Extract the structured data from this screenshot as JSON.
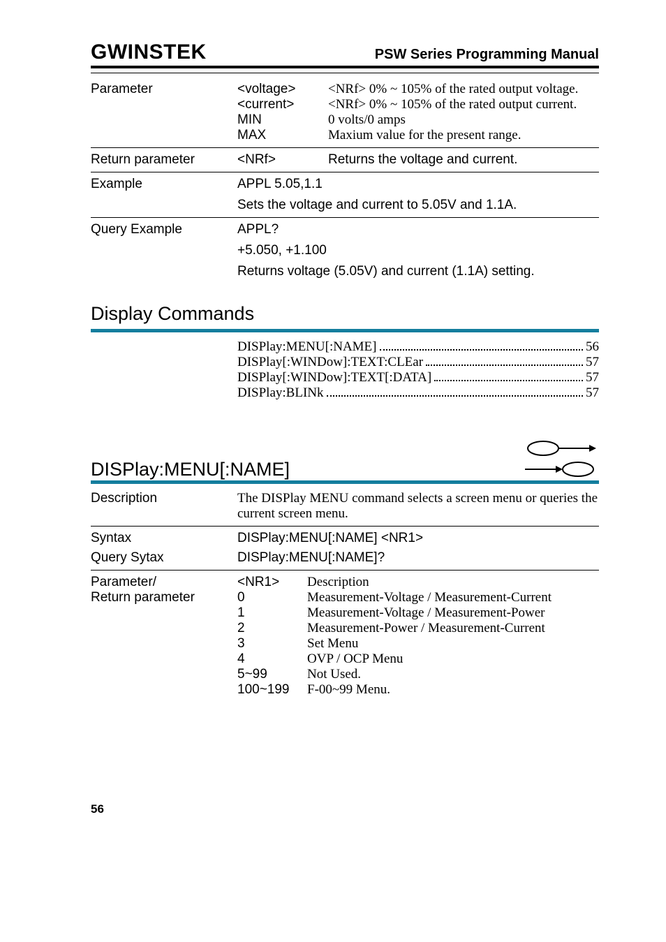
{
  "header": {
    "logo": "GWINSTEK",
    "title": "PSW Series Programming Manual"
  },
  "param_block": {
    "label": "Parameter",
    "rows": [
      {
        "mid": "<voltage>",
        "val": "<NRf> 0% ~ 105% of the rated output voltage."
      },
      {
        "mid": "<current>",
        "val": "<NRf> 0% ~ 105% of the rated output current."
      },
      {
        "mid": "MIN",
        "val": "0 volts/0 amps"
      },
      {
        "mid": "MAX",
        "val": "Maxium value for the present range."
      }
    ]
  },
  "return_param": {
    "label": "Return parameter",
    "mid": "<NRf>",
    "val": "Returns the voltage and current."
  },
  "example": {
    "label": "Example",
    "line1": "APPL 5.05,1.1",
    "line2": "Sets the voltage and current to 5.05V and 1.1A."
  },
  "query_example": {
    "label": "Query Example",
    "line1": "APPL?",
    "line2": "+5.050, +1.100",
    "line3": "Returns voltage (5.05V) and current (1.1A) setting."
  },
  "display_cmds": {
    "heading": "Display Commands",
    "toc": [
      {
        "t": "DISPlay:MENU[:NAME]",
        "p": "56"
      },
      {
        "t": "DISPlay[:WINDow]:TEXT:CLEar",
        "p": "57"
      },
      {
        "t": "DISPlay[:WINDow]:TEXT[:DATA]",
        "p": "57"
      },
      {
        "t": "DISPlay:BLINk",
        "p": "57"
      }
    ]
  },
  "cmd": {
    "title": "DISPlay:MENU[:NAME]",
    "desc_label": "Description",
    "desc_val": "The DISPlay MENU command selects a screen menu or queries the current screen menu.",
    "syntax_label": "Syntax",
    "syntax_val": "DISPlay:MENU[:NAME] <NR1>",
    "qsyntax_label": "Query Sytax",
    "qsyntax_val": "DISPlay:MENU[:NAME]?",
    "ptable": {
      "label1": "Parameter/",
      "label2": "Return parameter",
      "header_mid": "<NR1>",
      "header_val": "Description",
      "rows": [
        {
          "m": "0",
          "v": "Measurement-Voltage / Measurement-Current"
        },
        {
          "m": "1",
          "v": "Measurement-Voltage / Measurement-Power"
        },
        {
          "m": "2",
          "v": "Measurement-Power / Measurement-Current"
        },
        {
          "m": "3",
          "v": "Set Menu"
        },
        {
          "m": "4",
          "v": "OVP / OCP Menu"
        },
        {
          "m": "5~99",
          "v": "Not Used."
        },
        {
          "m": "100~199",
          "v": "F-00~99 Menu."
        }
      ]
    }
  },
  "footer": {
    "page": "56"
  }
}
